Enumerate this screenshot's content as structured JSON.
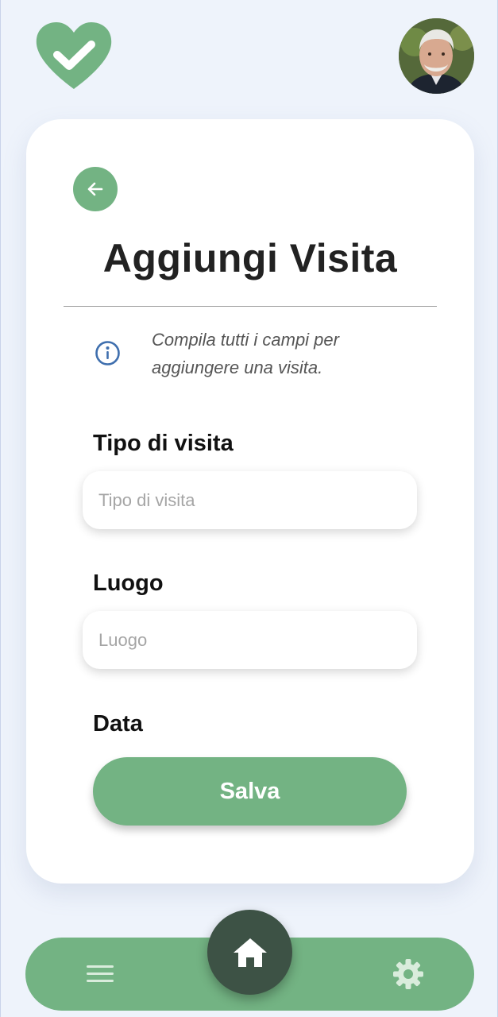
{
  "header": {
    "logo_icon": "heart-check-icon",
    "avatar_icon": "user-avatar"
  },
  "form": {
    "title": "Aggiungi Visita",
    "info_icon": "info-icon",
    "info_text": "Compila tutti i campi per aggiungere una visita.",
    "fields": [
      {
        "label": "Tipo di visita",
        "placeholder": "Tipo di visita",
        "value": ""
      },
      {
        "label": "Luogo",
        "placeholder": "Luogo",
        "value": ""
      },
      {
        "label": "Data"
      }
    ],
    "save_label": "Salva"
  },
  "nav": {
    "menu_icon": "hamburger-menu-icon",
    "home_icon": "home-icon",
    "settings_icon": "gear-icon"
  },
  "colors": {
    "accent_green": "#73b383",
    "dark_green": "#3d5245",
    "background": "#eef3fb",
    "info_blue": "#3f6fae"
  }
}
